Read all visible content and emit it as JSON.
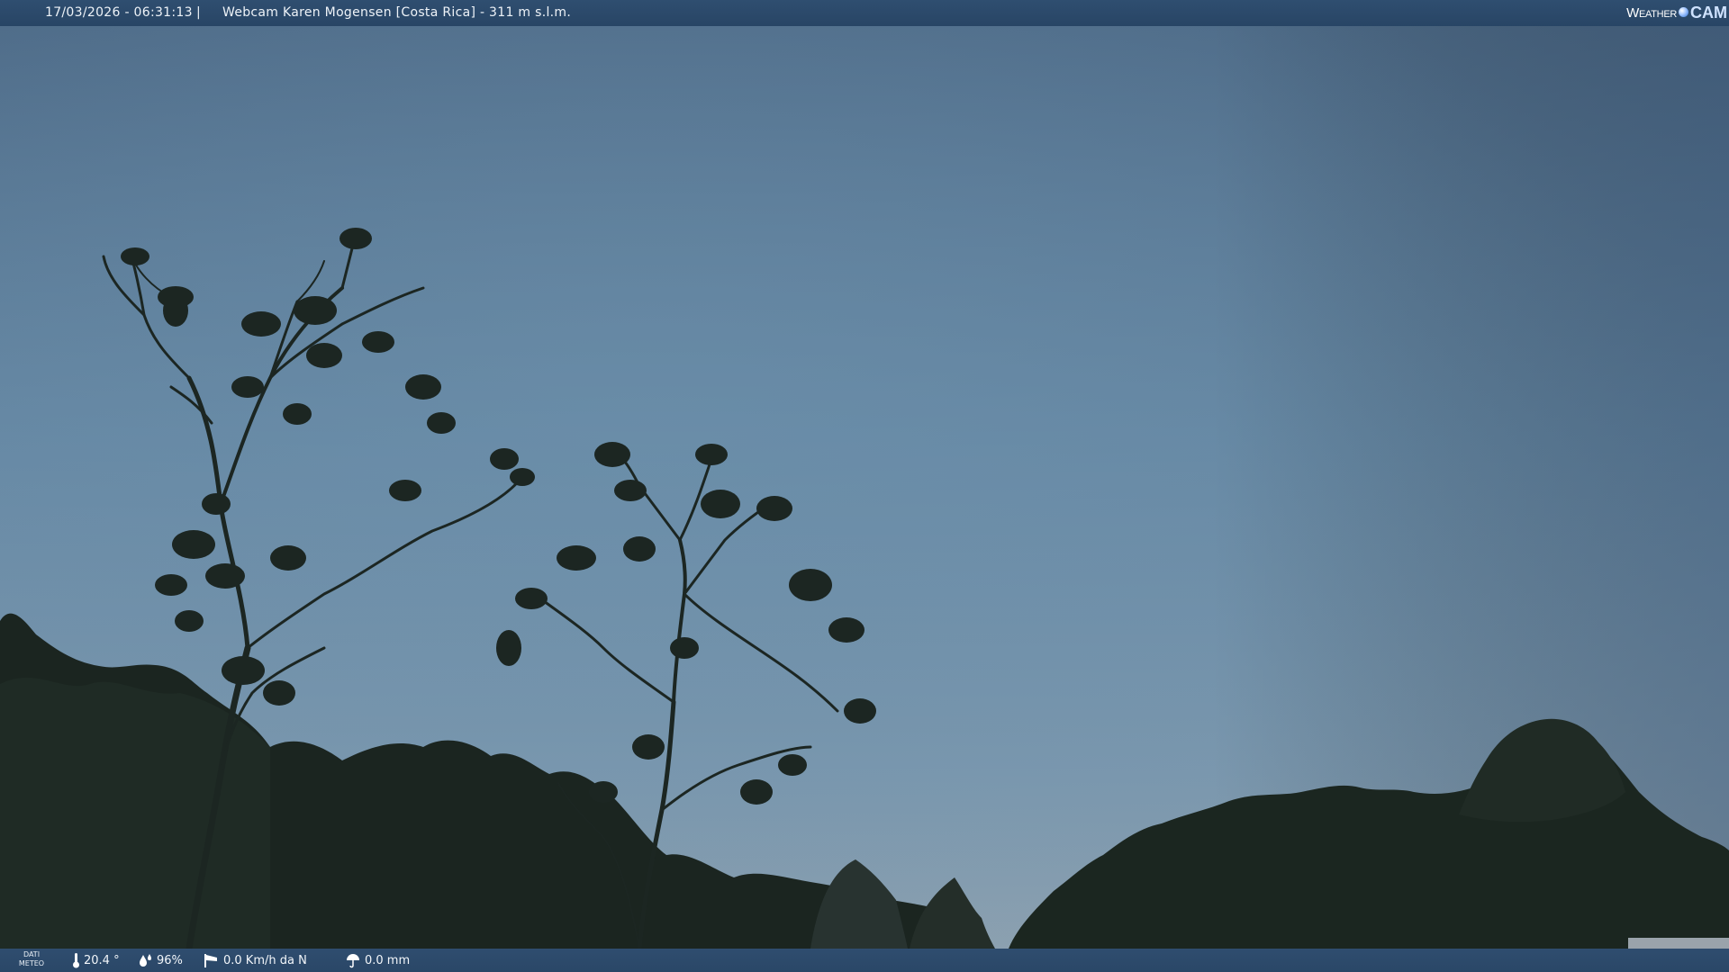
{
  "overlay": {
    "datetime": "17/03/2026 - 06:31:13",
    "separator": "|",
    "title": "Webcam Karen Mogensen [Costa Rica] - 311 m s.l.m."
  },
  "brand": {
    "word": "Weather",
    "cam": "CAM"
  },
  "meteo": {
    "label_line1": "DATI",
    "label_line2": "METEO",
    "temperature": "20.4 °",
    "humidity": "96%",
    "wind": "0.0 Km/h da N",
    "rain": "0.0 mm",
    "icons": [
      "thermometer-icon",
      "humidity-drop-icon",
      "wind-sock-icon",
      "rain-umbrella-icon"
    ]
  },
  "colors": {
    "sky_top": "#4e6a86",
    "sky_mid": "#6a8aa6",
    "sky_horizon": "#8ba0b0",
    "foliage": "#1c2520",
    "bar": "#2b4868"
  }
}
